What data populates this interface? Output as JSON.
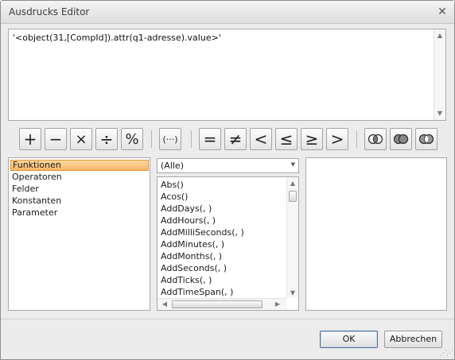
{
  "window": {
    "title": "Ausdrucks Editor",
    "close_glyph": "✕"
  },
  "editor": {
    "expression": "'<object(31,[CompId]).attr(q1-adresse).value>'"
  },
  "operators": {
    "plus": "+",
    "minus": "−",
    "multiply": "×",
    "divide": "÷",
    "modulo": "%",
    "parentheses": "(···)",
    "equal": "=",
    "not_equal": "≠",
    "less": "<",
    "less_equal": "≤",
    "greater_equal": "≥",
    "greater": ">",
    "icons": [
      "and-circles-icon",
      "or-circles-icon",
      "xor-circles-icon"
    ]
  },
  "categories": {
    "items": [
      "Funktionen",
      "Operatoren",
      "Felder",
      "Konstanten",
      "Parameter"
    ],
    "selected": "Funktionen"
  },
  "filter": {
    "selected": "(Alle)"
  },
  "functions": {
    "items": [
      "Abs()",
      "Acos()",
      "AddDays(, )",
      "AddHours(, )",
      "AddMilliSeconds(, )",
      "AddMinutes(, )",
      "AddMonths(, )",
      "AddSeconds(, )",
      "AddTicks(, )",
      "AddTimeSpan(, )"
    ]
  },
  "buttons": {
    "ok": "OK",
    "cancel": "Abbrechen"
  },
  "colors": {
    "selection": "#f7b56a",
    "window_bg": "#ececec"
  }
}
